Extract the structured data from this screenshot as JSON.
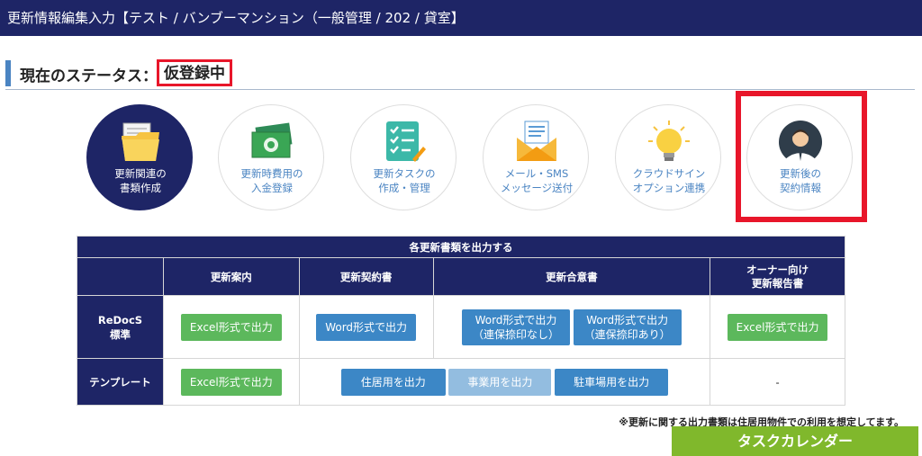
{
  "header": {
    "title": "更新情報編集入力【テスト / バンブーマンション（一般管理 / 202 / 貸室】"
  },
  "status": {
    "label": "現在のステータス：",
    "value": "仮登録中"
  },
  "steps": [
    {
      "label": "更新関連の\n書類作成",
      "icon": "folder-icon"
    },
    {
      "label": "更新時費用の\n入金登録",
      "icon": "money-icon"
    },
    {
      "label": "更新タスクの\n作成・管理",
      "icon": "checklist-icon"
    },
    {
      "label": "メール・SMS\nメッセージ送付",
      "icon": "mail-icon"
    },
    {
      "label": "クラウドサイン\nオプション連携",
      "icon": "lightbulb-icon"
    },
    {
      "label": "更新後の\n契約情報",
      "icon": "person-icon"
    }
  ],
  "table": {
    "title": "各更新書類を出力する",
    "columns": [
      "更新案内",
      "更新契約書",
      "更新合意書",
      "オーナー向け\n更新報告書"
    ],
    "rows": {
      "redocs": {
        "label": "ReDocS\n標準",
        "guide_btn": "Excel形式で出力",
        "contract_btn": "Word形式で出力",
        "agree_btn1": "Word形式で出力\n（連保捺印なし）",
        "agree_btn2": "Word形式で出力\n（連保捺印あり）",
        "owner_btn": "Excel形式で出力"
      },
      "template": {
        "label": "テンプレート",
        "guide_btn": "Excel形式で出力",
        "residence_btn": "住居用を出力",
        "business_btn": "事業用を出力",
        "parking_btn": "駐車場用を出力",
        "owner_value": "-"
      }
    }
  },
  "note": "※更新に関する出力書類は住居用物件での利用を想定してます。",
  "task_button": "タスクカレンダー",
  "colors": {
    "navy": "#1e2566",
    "accent_blue": "#4a84c2",
    "green": "#5cb85c",
    "red": "#e8162a",
    "lime": "#80b82c"
  }
}
